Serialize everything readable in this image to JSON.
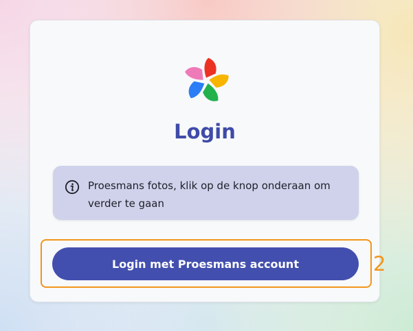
{
  "app": {
    "title": "Login",
    "logo_icon": "photos-pinwheel-icon"
  },
  "info": {
    "icon": "info-circle-icon",
    "message": "Proesmans fotos, klik op de knop onderaan om verder te gaan"
  },
  "login_button": {
    "label": "Login met Proesmans account"
  },
  "annotation": {
    "number": "2",
    "color": "#f2951a"
  },
  "colors": {
    "accent": "#434fae",
    "title": "#3f4ba8",
    "info_background": "#cfd2ea",
    "logo_red": "#ec3223",
    "logo_yellow": "#f7b500",
    "logo_green": "#22b14c",
    "logo_blue": "#2a7df5",
    "logo_pink": "#ef7ab8"
  }
}
